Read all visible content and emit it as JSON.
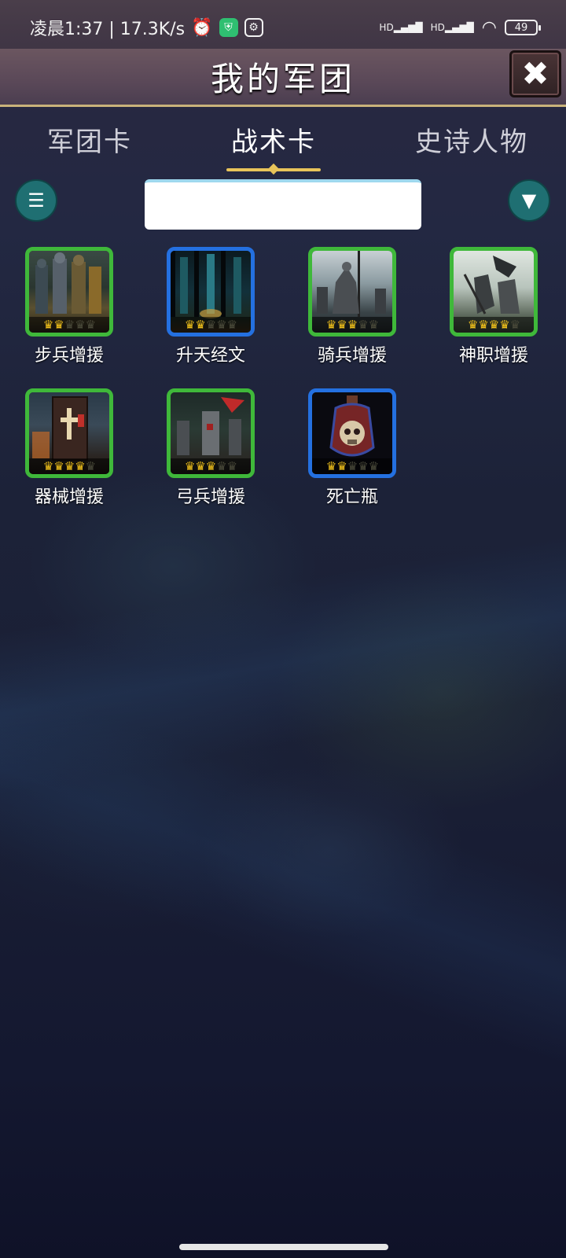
{
  "status_bar": {
    "time": "凌晨1:37 | 17.3K/s",
    "network_a": "HD",
    "network_b": "HD",
    "battery": "49"
  },
  "header": {
    "title": "我的军团"
  },
  "tabs": [
    {
      "label": "军团卡",
      "active": false
    },
    {
      "label": "战术卡",
      "active": true
    },
    {
      "label": "史诗人物",
      "active": false
    }
  ],
  "search": {
    "value": "",
    "placeholder": ""
  },
  "cards": [
    {
      "label": "步兵增援",
      "frame": "green",
      "stars": 2
    },
    {
      "label": "升天经文",
      "frame": "blue",
      "stars": 2
    },
    {
      "label": "骑兵增援",
      "frame": "green",
      "stars": 3
    },
    {
      "label": "神职增援",
      "frame": "green",
      "stars": 4
    },
    {
      "label": "器械增援",
      "frame": "green",
      "stars": 4
    },
    {
      "label": "弓兵增援",
      "frame": "green",
      "stars": 3
    },
    {
      "label": "死亡瓶",
      "frame": "blue",
      "stars": 2
    }
  ],
  "colors": {
    "frame_green": "#3fb83a",
    "frame_blue": "#2470e0",
    "accent_gold": "#e8c45a",
    "teal_button": "#1f6f72"
  }
}
